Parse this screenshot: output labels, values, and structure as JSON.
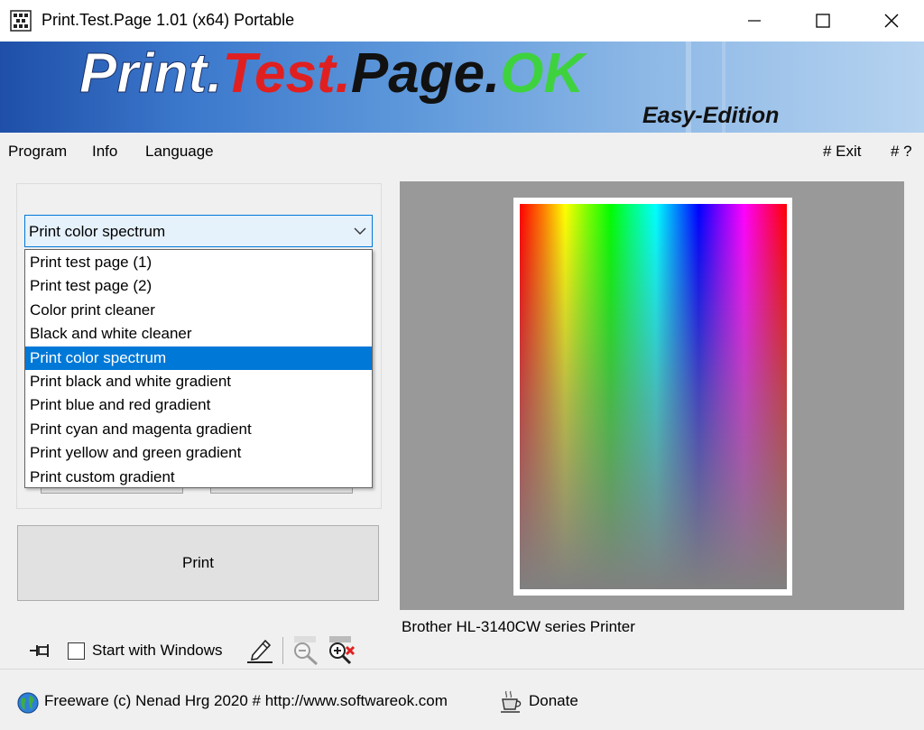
{
  "window": {
    "title": "Print.Test.Page 1.01  (x64) Portable",
    "icons": {
      "app": "printer-test-icon",
      "minimize": "minimize-icon",
      "maximize": "maximize-icon",
      "close": "close-icon"
    }
  },
  "banner": {
    "part1": "Print.",
    "part2": "Test.",
    "part3": "Page.",
    "part4": "OK",
    "edition": "Easy-Edition",
    "colors": {
      "part1": "#ffffff",
      "part2": "#e02020",
      "part3": "#111111",
      "part4": "#3fd23f",
      "edition": "#111111"
    }
  },
  "menu": {
    "left": [
      "Program",
      "Info",
      "Language"
    ],
    "exit": "# Exit",
    "help": "# ?"
  },
  "combo": {
    "selected": "Print color spectrum",
    "options": [
      "Print test page (1)",
      "Print test page (2)",
      "Color print cleaner",
      "Black and white cleaner",
      "Print color spectrum",
      "Print black and white gradient",
      "Print blue and red gradient",
      "Print cyan and magenta gradient",
      "Print yellow and green gradient",
      "Print custom gradient"
    ],
    "highlighted_index": 4
  },
  "print_button": "Print",
  "autostart": {
    "label": "Start with Windows",
    "checked": false
  },
  "tools": {
    "pin": "pin-icon",
    "edit": "edit-icon",
    "zoom_out": "zoom-out-icon",
    "zoom_in": "zoom-in-icon"
  },
  "preview": {
    "printer": "Brother HL-3140CW series Printer"
  },
  "status": {
    "freeware": "Freeware (c) Nenad Hrg 2020 # http://www.softwareok.com",
    "donate": "Donate"
  },
  "colors": {
    "accent": "#0078d7",
    "selection_bg": "#0078d7",
    "preview_bg": "#999999"
  }
}
